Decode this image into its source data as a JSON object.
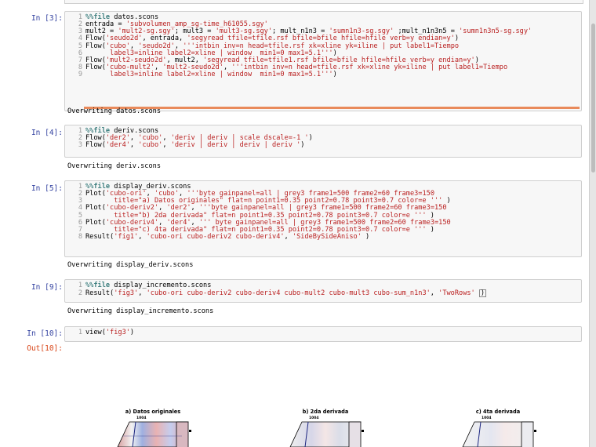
{
  "cells": [
    {
      "prompt": "In [3]:",
      "lines": [
        [
          {
            "t": "%%file",
            "c": "cm"
          },
          {
            "t": " datos.scons"
          }
        ],
        [
          {
            "t": "entrada = "
          },
          {
            "t": "'subvolumen_amp_sg-time_h61055.sgy'",
            "c": "st"
          }
        ],
        [
          {
            "t": "mult2 = "
          },
          {
            "t": "'mult2-sg.sgy'",
            "c": "st"
          },
          {
            "t": "; mult3 = "
          },
          {
            "t": "'mult3-sg.sgy'",
            "c": "st"
          },
          {
            "t": "; mult_n1n3 = "
          },
          {
            "t": "'sumn1n3-sg.sgy'",
            "c": "st"
          },
          {
            "t": " ;mult_n1n3n5 = "
          },
          {
            "t": "'sumn1n3n5-sg.sgy'",
            "c": "st"
          }
        ],
        [
          {
            "t": "Flow("
          },
          {
            "t": "'seudo2d'",
            "c": "st"
          },
          {
            "t": ", entrada, "
          },
          {
            "t": "'segyread tfile=tfile.rsf bfile=bfile hfile=hfile verb=y endian=y'",
            "c": "st"
          },
          {
            "t": ")"
          }
        ],
        [
          {
            "t": "Flow("
          },
          {
            "t": "'cubo'",
            "c": "st"
          },
          {
            "t": ", "
          },
          {
            "t": "'seudo2d'",
            "c": "st"
          },
          {
            "t": ", "
          },
          {
            "t": "'''intbin inv=n head=tfile.rsf xk=xline yk=iline | put label1=Tiempo",
            "c": "st"
          }
        ],
        [
          {
            "t": "      label3=inline label2=xline | window  min1=0 max1=5.1'''",
            "c": "st"
          },
          {
            "t": ")"
          }
        ],
        [
          {
            "t": "Flow("
          },
          {
            "t": "'mult2-seudo2d'",
            "c": "st"
          },
          {
            "t": ", mult2, "
          },
          {
            "t": "'segyread tfile=tfile1.rsf bfile=bfile hfile=hfile verb=y endian=y'",
            "c": "st"
          },
          {
            "t": ")"
          }
        ],
        [
          {
            "t": "Flow("
          },
          {
            "t": "'cubo-mult2'",
            "c": "st"
          },
          {
            "t": ", "
          },
          {
            "t": "'mult2-seudo2d'",
            "c": "st"
          },
          {
            "t": ", "
          },
          {
            "t": "'''intbin inv=n head=tfile.rsf xk=xline yk=iline | put label1=Tiempo",
            "c": "st"
          }
        ],
        [
          {
            "t": "      label3=inline label2=xline | window  min1=0 max1=5.1'''",
            "c": "st"
          },
          {
            "t": ")"
          }
        ]
      ],
      "output": "Overwriting datos.scons"
    },
    {
      "prompt": "In [4]:",
      "lines": [
        [
          {
            "t": "%%file",
            "c": "cm"
          },
          {
            "t": " deriv.scons"
          }
        ],
        [
          {
            "t": "Flow("
          },
          {
            "t": "'der2'",
            "c": "st"
          },
          {
            "t": ", "
          },
          {
            "t": "'cubo'",
            "c": "st"
          },
          {
            "t": ", "
          },
          {
            "t": "'deriv | deriv | scale dscale=-1 '",
            "c": "st"
          },
          {
            "t": ")"
          }
        ],
        [
          {
            "t": "Flow("
          },
          {
            "t": "'der4'",
            "c": "st"
          },
          {
            "t": ", "
          },
          {
            "t": "'cubo'",
            "c": "st"
          },
          {
            "t": ", "
          },
          {
            "t": "'deriv | deriv | deriv | deriv '",
            "c": "st"
          },
          {
            "t": ")"
          }
        ]
      ],
      "output": "Overwriting deriv.scons"
    },
    {
      "prompt": "In [5]:",
      "lines": [
        [
          {
            "t": "%%file",
            "c": "cm"
          },
          {
            "t": " display_deriv.scons"
          }
        ],
        [
          {
            "t": "Plot("
          },
          {
            "t": "'cubo-ori'",
            "c": "st"
          },
          {
            "t": ", "
          },
          {
            "t": "'cubo'",
            "c": "st"
          },
          {
            "t": ", "
          },
          {
            "t": "'''byte gainpanel=all | grey3 frame1=500 frame2=60 frame3=150",
            "c": "st"
          }
        ],
        [
          {
            "t": "       title=\"a) Datos originales\" flat=n point1=0.35 point2=0.78 point3=0.7 color=e '''",
            "c": "st"
          },
          {
            "t": " )"
          }
        ],
        [
          {
            "t": "Plot("
          },
          {
            "t": "'cubo-deriv2'",
            "c": "st"
          },
          {
            "t": ", "
          },
          {
            "t": "'der2'",
            "c": "st"
          },
          {
            "t": ", "
          },
          {
            "t": "'''byte gainpanel=all | grey3 frame1=500 frame2=60 frame3=150",
            "c": "st"
          }
        ],
        [
          {
            "t": "       title=\"b) 2da derivada\" flat=n point1=0.35 point2=0.78 point3=0.7 color=e '''",
            "c": "st"
          },
          {
            "t": " )"
          }
        ],
        [
          {
            "t": "Plot("
          },
          {
            "t": "'cubo-deriv4'",
            "c": "st"
          },
          {
            "t": ", "
          },
          {
            "t": "'der4'",
            "c": "st"
          },
          {
            "t": ", "
          },
          {
            "t": "''' byte gainpanel=all | grey3 frame1=500 frame2=60 frame3=150",
            "c": "st"
          }
        ],
        [
          {
            "t": "       title=\"c) 4ta derivada\" flat=n point1=0.35 point2=0.78 point3=0.7 color=e '''",
            "c": "st"
          },
          {
            "t": " )"
          }
        ],
        [
          {
            "t": "Result("
          },
          {
            "t": "'fig1'",
            "c": "st"
          },
          {
            "t": ", "
          },
          {
            "t": "'cubo-ori cubo-deriv2 cubo-deriv4'",
            "c": "st"
          },
          {
            "t": ", "
          },
          {
            "t": "'SideBySideAniso'",
            "c": "st"
          },
          {
            "t": " )"
          }
        ]
      ],
      "output": "Overwriting display_deriv.scons"
    },
    {
      "prompt": "In [9]:",
      "lines": [
        [
          {
            "t": "%%file",
            "c": "cm"
          },
          {
            "t": " display_incremento.scons"
          }
        ],
        [
          {
            "t": "Result("
          },
          {
            "t": "'fig3'",
            "c": "st"
          },
          {
            "t": ", "
          },
          {
            "t": "'cubo-ori cubo-deriv2 cubo-deriv4 cubo-mult2 cubo-mult3 cubo-sum_n1n3'",
            "c": "st"
          },
          {
            "t": ", "
          },
          {
            "t": "'TwoRows'",
            "c": "st"
          },
          {
            "t": " "
          },
          {
            "t": ")",
            "box": true
          }
        ]
      ],
      "output": "Overwriting display_incremento.scons"
    },
    {
      "prompt": "In [10]:",
      "lines": [
        [
          {
            "t": "view("
          },
          {
            "t": "'fig3'",
            "c": "st"
          },
          {
            "t": ")"
          }
        ]
      ],
      "output": ""
    }
  ],
  "out_prompt": "Out[10]:",
  "figure": {
    "panels": [
      {
        "title": "a) Datos originales",
        "tick": "1004"
      },
      {
        "title": "b) 2da derivada",
        "tick": "1004"
      },
      {
        "title": "c) 4ta derivada",
        "tick": "1004"
      }
    ]
  },
  "colors": {
    "prompt_in": "#303f9f",
    "prompt_out": "#d84315",
    "string": "#ba2121",
    "magic": "#408080"
  }
}
